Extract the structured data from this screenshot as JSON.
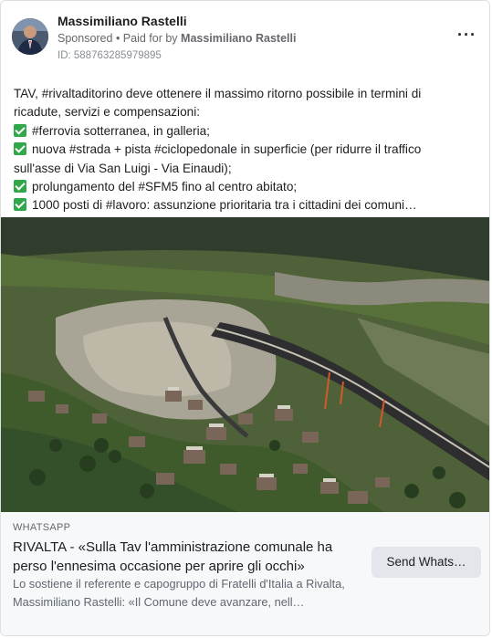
{
  "post": {
    "author": "Massimiliano Rastelli",
    "sponsored_label": "Sponsored",
    "paid_for_prefix": " • Paid for by ",
    "paid_for_name": "Massimiliano Rastelli",
    "ad_id": "ID: 588763285979895",
    "more_icon": "more-options-icon",
    "body_lines": [
      {
        "check": false,
        "text": "TAV, #rivaltaditorino deve ottenere il massimo ritorno possibile in termini di"
      },
      {
        "check": false,
        "text": "ricadute, servizi e compensazioni:"
      },
      {
        "check": true,
        "text": "#ferrovia sotterranea, in galleria;"
      },
      {
        "check": true,
        "text": "nuova #strada + pista #ciclopedonale in superficie (per ridurre il traffico"
      },
      {
        "check": false,
        "text": "sull'asse di Via San Luigi - Via Einaudi);"
      },
      {
        "check": true,
        "text": "prolungamento del #SFM5 fino al centro abitato;"
      },
      {
        "check": true,
        "text": "1000 posti di #lavoro: assunzione prioritaria tra i cittadini dei comuni…"
      }
    ]
  },
  "link": {
    "source": "WHATSAPP",
    "title": "RIVALTA - «Sulla Tav l'amministrazione comunale ha perso l'ennesima occasione per aprire gli occhi»",
    "description": "Lo sostiene il referente e capogruppo di Fratelli d'Italia a Rivalta, Massimiliano Rastelli: «Il Comune deve avanzare, nell…",
    "cta_label": "Send Whats…"
  },
  "colors": {
    "check_green": "#30a84a",
    "link_bg": "#f7f8fa",
    "button_bg": "#e4e6eb"
  }
}
